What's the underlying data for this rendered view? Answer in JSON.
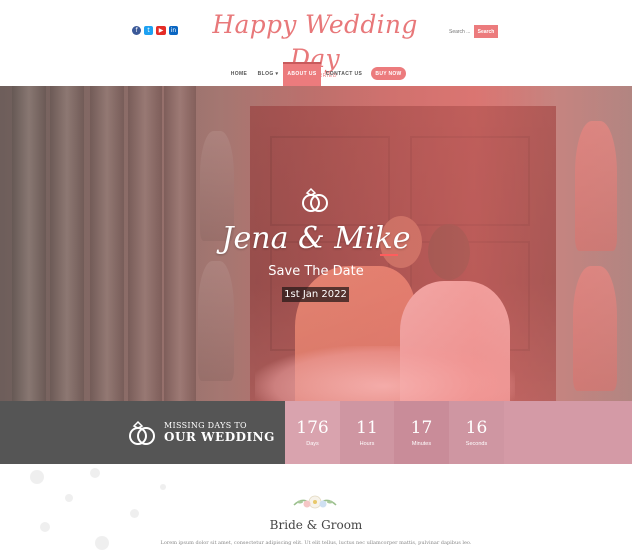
{
  "header": {
    "socials": [
      "facebook-icon",
      "twitter-icon",
      "youtube-icon",
      "linkedin-icon"
    ],
    "logo_title": "Happy Wedding Day",
    "logo_tagline": "JUST MARRIED",
    "search_placeholder": "Search ...",
    "search_button": "Search"
  },
  "nav": {
    "items": [
      {
        "label": "HOME",
        "active": false
      },
      {
        "label": "BLOG ▾",
        "active": false
      },
      {
        "label": "ABOUT US",
        "active": true
      },
      {
        "label": "CONTACT US",
        "active": false
      }
    ],
    "buy_now": "BUY NOW"
  },
  "hero": {
    "couple_names": "Jena & Mike",
    "tagline": "Save The Date",
    "date": "1st Jan 2022"
  },
  "countdown": {
    "line1": "MISSING DAYS TO",
    "line2": "OUR WEDDING",
    "units": [
      {
        "value": "176",
        "label": "Days"
      },
      {
        "value": "11",
        "label": "Hours"
      },
      {
        "value": "17",
        "label": "Minutes"
      },
      {
        "value": "16",
        "label": "Seconds"
      }
    ]
  },
  "section": {
    "title": "Bride & Groom",
    "text": "Lorem ipsum dolor sit amet, consectetur adipiscing elit. Ut elit tellus, luctus nec ullamcorper mattis, pulvinar dapibus leo."
  },
  "colors": {
    "accent": "#ec7b7d",
    "countdown_dark": "#555555",
    "countdown_pink": [
      "#d9a3ae",
      "#cf96a2",
      "#c98c99",
      "#cf96a2"
    ]
  }
}
